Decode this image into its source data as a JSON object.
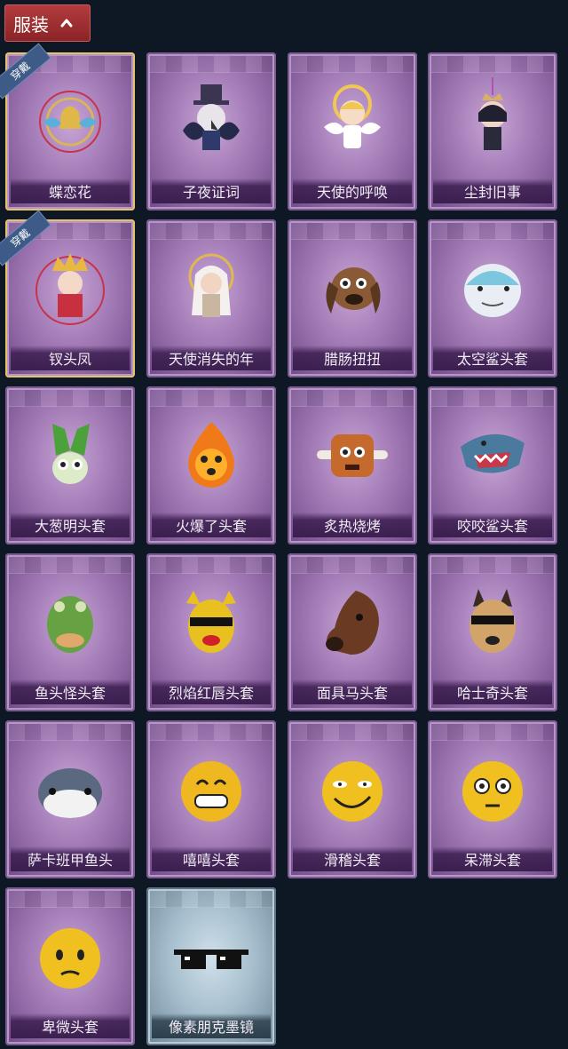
{
  "header": {
    "label": "服装"
  },
  "badge_label": "穿戴",
  "items": [
    {
      "name": "蝶恋花",
      "equipped": true,
      "icon": "butterfly-bell-charm-icon"
    },
    {
      "name": "子夜证词",
      "equipped": false,
      "icon": "crow-top-hat-figure-icon"
    },
    {
      "name": "天使的呼唤",
      "equipped": false,
      "icon": "angel-halo-figure-icon"
    },
    {
      "name": "尘封旧事",
      "equipped": false,
      "icon": "crowned-figure-icon"
    },
    {
      "name": "钗头凤",
      "equipped": true,
      "icon": "phoenix-crown-figure-icon"
    },
    {
      "name": "天使消失的年",
      "equipped": false,
      "icon": "veiled-angel-figure-icon"
    },
    {
      "name": "腊肠扭扭",
      "equipped": false,
      "icon": "dachshund-mask-icon"
    },
    {
      "name": "太空鲨头套",
      "equipped": false,
      "icon": "space-shark-mask-icon"
    },
    {
      "name": "大葱明头套",
      "equipped": false,
      "icon": "green-onion-mask-icon"
    },
    {
      "name": "火爆了头套",
      "equipped": false,
      "icon": "fire-mask-icon"
    },
    {
      "name": "炙热烧烤",
      "equipped": false,
      "icon": "grilled-meat-mask-icon"
    },
    {
      "name": "咬咬鲨头套",
      "equipped": false,
      "icon": "biting-shark-mask-icon"
    },
    {
      "name": "鱼头怪头套",
      "equipped": false,
      "icon": "fish-head-mask-icon"
    },
    {
      "name": "烈焰红唇头套",
      "equipped": false,
      "icon": "red-lips-yellow-mask-icon"
    },
    {
      "name": "面具马头套",
      "equipped": false,
      "icon": "horse-mask-icon"
    },
    {
      "name": "哈士奇头套",
      "equipped": false,
      "icon": "husky-mask-icon"
    },
    {
      "name": "萨卡班甲鱼头",
      "equipped": false,
      "icon": "sacabambaspis-mask-icon"
    },
    {
      "name": "嘻嘻头套",
      "equipped": false,
      "icon": "grin-emoji-mask-icon"
    },
    {
      "name": "滑稽头套",
      "equipped": false,
      "icon": "funny-emoji-mask-icon"
    },
    {
      "name": "呆滞头套",
      "equipped": false,
      "icon": "stunned-emoji-mask-icon"
    },
    {
      "name": "卑微头套",
      "equipped": false,
      "icon": "humble-emoji-mask-icon"
    },
    {
      "name": "像素朋克墨镜",
      "equipped": false,
      "icon": "pixel-sunglasses-icon",
      "rarity": "blue"
    }
  ]
}
